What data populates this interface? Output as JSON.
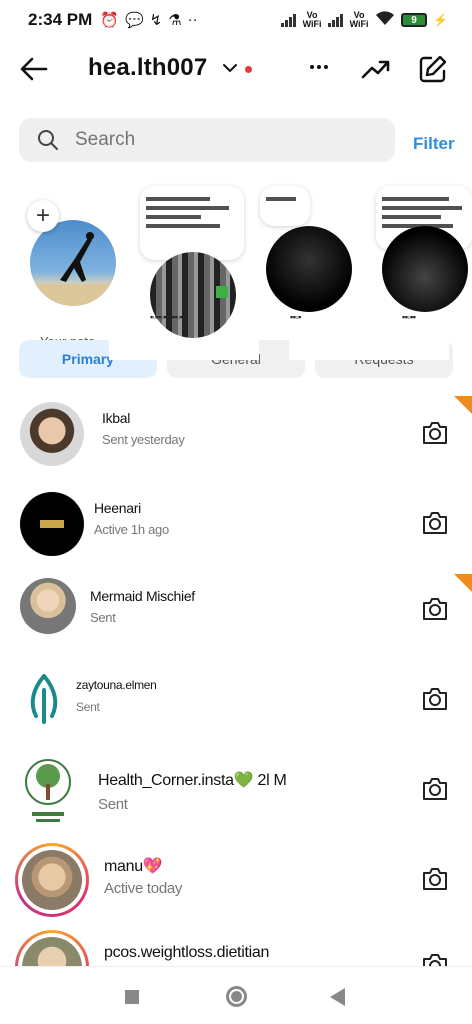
{
  "status_bar": {
    "time": "2:34 PM",
    "vowifi_1": "Vo WiFi",
    "vowifi_2": "Vo WiFi",
    "battery": "9"
  },
  "header": {
    "username": "hea.lth007",
    "icons": [
      "back-arrow-icon",
      "chevron-down-icon",
      "more-icon",
      "trending-icon",
      "compose-icon"
    ]
  },
  "search": {
    "placeholder": "Search",
    "filter_label": "Filter"
  },
  "notes": {
    "self_label": "Your note"
  },
  "tabs": [
    {
      "label": "Primary",
      "active": true
    },
    {
      "label": "General",
      "active": false
    },
    {
      "label": "Requests",
      "active": false
    }
  ],
  "chats": [
    {
      "name": "Ikbal",
      "sub": "Sent yesterday",
      "unread": true
    },
    {
      "name": "Heenari",
      "sub": "Active 1h ago",
      "unread": false
    },
    {
      "name": "Mermaid Mischief",
      "sub": "Sent",
      "unread": true
    },
    {
      "name": "zaytouna.elmen",
      "sub": "Sent",
      "unread": false
    },
    {
      "name": "Health_Corner.insta💚 2l   M",
      "sub": "Sent",
      "unread": false
    },
    {
      "name": "manu💖",
      "sub": "Active today",
      "unread": false
    },
    {
      "name": "pcos.weightloss.dietitian",
      "sub": "",
      "unread": false
    }
  ],
  "colors": {
    "accent": "#2f8ee3",
    "unread_corner": "#f08c1e",
    "tab_active_bg": "#e2f0fd"
  }
}
